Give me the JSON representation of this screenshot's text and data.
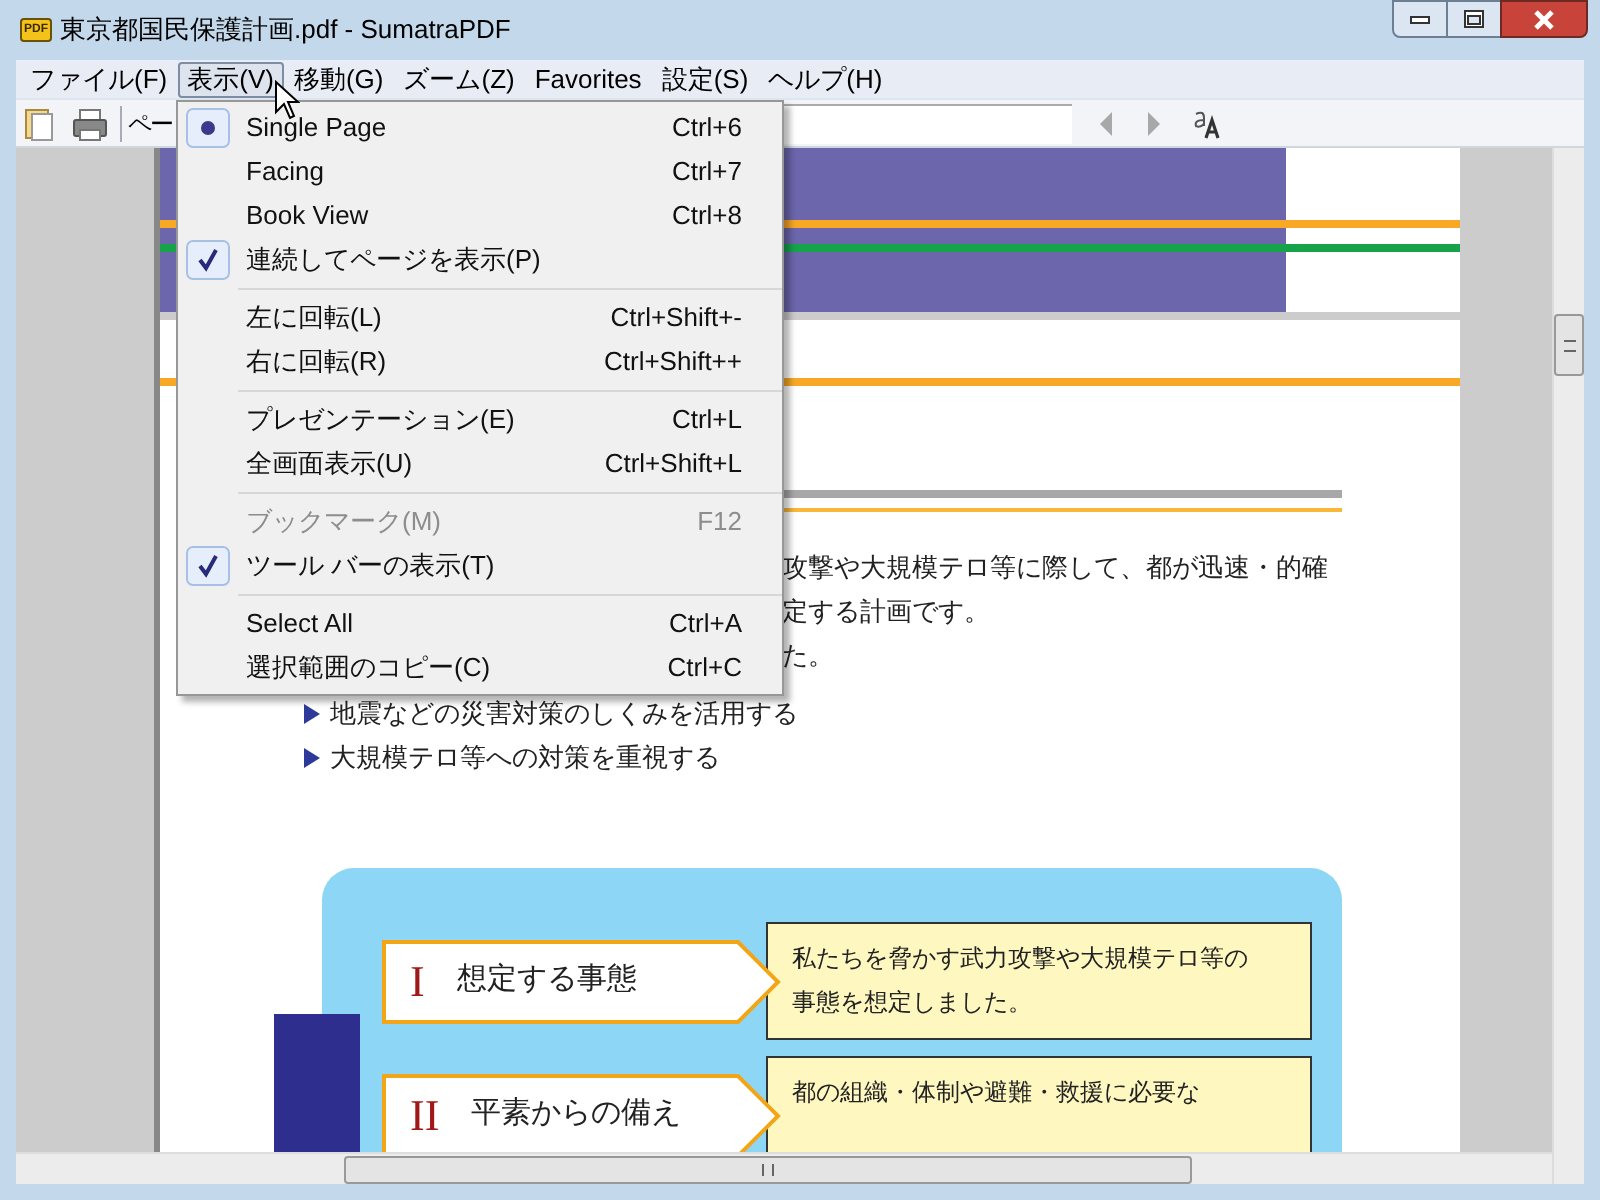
{
  "window": {
    "title": "東京都国民保護計画.pdf - SumatraPDF",
    "app_icon_text": "PDF"
  },
  "menu_bar": [
    {
      "label": "ファイル(F)",
      "selected": false
    },
    {
      "label": "表示(V)",
      "selected": true
    },
    {
      "label": "移動(G)",
      "selected": false
    },
    {
      "label": "ズーム(Z)",
      "selected": false
    },
    {
      "label": "Favorites",
      "selected": false
    },
    {
      "label": "設定(S)",
      "selected": false
    },
    {
      "label": "ヘルプ(H)",
      "selected": false
    }
  ],
  "toolbar": {
    "page_label": "ペー"
  },
  "view_menu": [
    {
      "kind": "radio",
      "label": "Single Page",
      "shortcut": "Ctrl+6",
      "checked": true,
      "disabled": false
    },
    {
      "kind": "radio",
      "label": "Facing",
      "shortcut": "Ctrl+7",
      "checked": false,
      "disabled": false
    },
    {
      "kind": "radio",
      "label": "Book View",
      "shortcut": "Ctrl+8",
      "checked": false,
      "disabled": false
    },
    {
      "kind": "check",
      "label": "連続してページを表示(P)",
      "checked": true,
      "disabled": false
    },
    {
      "kind": "separator"
    },
    {
      "kind": "command",
      "label": "左に回転(L)",
      "shortcut": "Ctrl+Shift+-",
      "disabled": false
    },
    {
      "kind": "command",
      "label": "右に回転(R)",
      "shortcut": "Ctrl+Shift++",
      "disabled": false
    },
    {
      "kind": "separator"
    },
    {
      "kind": "command",
      "label": "プレゼンテーション(E)",
      "shortcut": "Ctrl+L",
      "disabled": false
    },
    {
      "kind": "command",
      "label": "全画面表示(U)",
      "shortcut": "Ctrl+Shift+L",
      "disabled": false
    },
    {
      "kind": "separator"
    },
    {
      "kind": "check",
      "label": "ブックマーク(M)",
      "shortcut": "F12",
      "checked": false,
      "disabled": true
    },
    {
      "kind": "check",
      "label": "ツール バーの表示(T)",
      "checked": true,
      "disabled": false
    },
    {
      "kind": "separator"
    },
    {
      "kind": "command",
      "label": "Select All",
      "shortcut": "Ctrl+A",
      "disabled": false
    },
    {
      "kind": "command",
      "label": "選択範囲のコピー(C)",
      "shortcut": "Ctrl+C",
      "disabled": false
    }
  ],
  "document": {
    "paragraph_lines": [
      "攻撃や大規模テロ等に際して、都が迅速・的確",
      "定する計画です。",
      "た。"
    ],
    "bullets": [
      "地震などの災害対策のしくみを活用する",
      "大規模テロ等への対策を重視する"
    ],
    "sections": [
      {
        "numeral": "I",
        "heading": "想定する事態",
        "description": "私たちを脅かす武力攻撃や大規模テロ等の事態を想定しました。"
      },
      {
        "numeral": "II",
        "heading": "平素からの備え",
        "description": "都の組織・体制や避難・救援に必要な"
      }
    ]
  }
}
